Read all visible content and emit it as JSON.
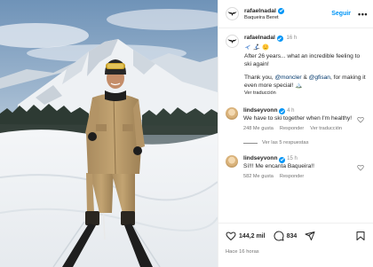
{
  "post": {
    "username": "rafaelnadal",
    "location": "Baqueira Beret",
    "follow_label": "Seguir",
    "more_label": "•••",
    "time": "16 h",
    "caption_line1": "After 26 years... what an incredible feeling to ski again!",
    "caption_thanks_start": "Thank you, ",
    "mention1": "@moncler",
    "caption_amp": " & ",
    "mention2": "@gfisan",
    "caption_thanks_end": ", for making it even more special! 🏔️",
    "see_translation": "Ver traducción",
    "emojis": [
      "plane",
      "ski",
      "heart-eyes"
    ]
  },
  "comments": [
    {
      "username": "lindseyvonn",
      "time": "4 h",
      "text": "We have to ski together when I'm healthy!",
      "likes": "248 Me gusta",
      "reply_label": "Responder",
      "translate_label": "Ver traducción",
      "view_replies": "Ver las 5 respuestas"
    },
    {
      "username": "lindseyvonn",
      "time": "15 h",
      "text": "Sí!!! Me encanta Baqueira!!",
      "likes": "582 Me gusta",
      "reply_label": "Responder"
    }
  ],
  "footer": {
    "likes_count": "144,2 mil",
    "comments_count": "834",
    "time_ago": "Hace 16 horas"
  },
  "colors": {
    "accent": "#0095f6",
    "mention": "#00376b",
    "secondary_text": "#737373"
  }
}
